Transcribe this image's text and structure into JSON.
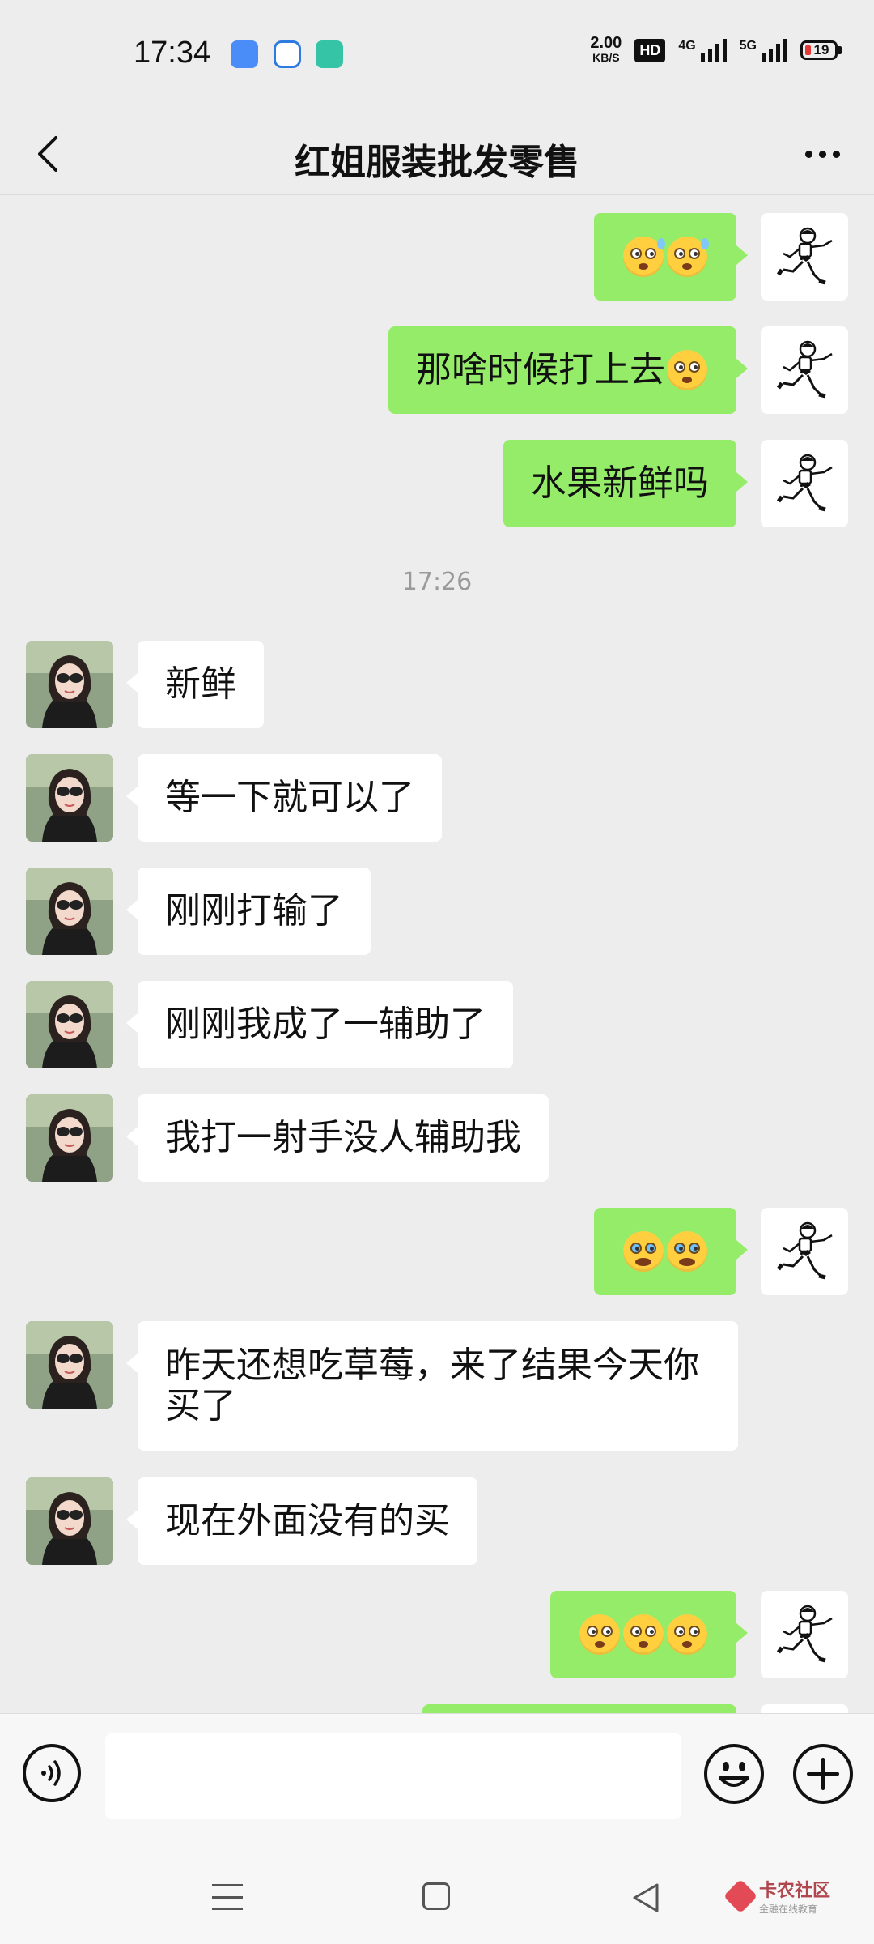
{
  "status_bar": {
    "time": "17:34",
    "net_speed_value": "2.00",
    "net_speed_unit": "KB/S",
    "hd_badge": "HD",
    "net1": "4G",
    "net2": "5G",
    "battery": "19"
  },
  "header": {
    "title": "红姐服装批发零售"
  },
  "messages": [
    {
      "side": "me",
      "text": "",
      "emojis": 2,
      "emoji_kind": "sweat"
    },
    {
      "side": "me",
      "text": "那啥时候打上去",
      "emojis": 1,
      "emoji_kind": "flushed"
    },
    {
      "side": "me",
      "text": "水果新鲜吗"
    },
    {
      "type": "time",
      "text": "17:26"
    },
    {
      "side": "her",
      "text": "新鲜"
    },
    {
      "side": "her",
      "text": "等一下就可以了"
    },
    {
      "side": "her",
      "text": "刚刚打输了"
    },
    {
      "side": "her",
      "text": "刚刚我成了一辅助了"
    },
    {
      "side": "her",
      "text": "我打一射手没人辅助我"
    },
    {
      "side": "me",
      "text": "",
      "emojis": 2,
      "emoji_kind": "cry"
    },
    {
      "side": "her",
      "text": "昨天还想吃草莓，来了结果今天你买了"
    },
    {
      "side": "her",
      "text": "现在外面没有的买"
    },
    {
      "side": "me",
      "text": "",
      "emojis": 3,
      "emoji_kind": "flushed"
    }
  ],
  "input": {
    "placeholder": ""
  },
  "watermark": {
    "title": "卡农社区",
    "subtitle": "金融在线教育"
  },
  "colors": {
    "my_bubble": "#95ec69",
    "her_bubble": "#ffffff",
    "background": "#ededed"
  }
}
